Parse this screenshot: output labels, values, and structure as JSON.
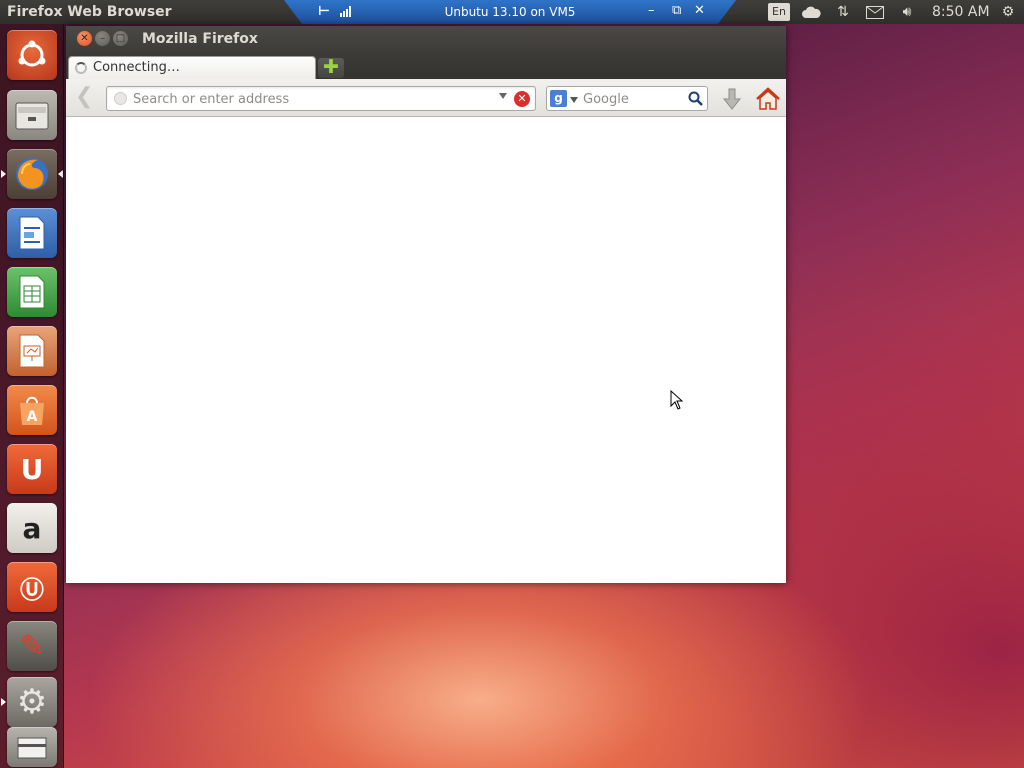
{
  "top_panel": {
    "app_title": "Firefox Web Browser",
    "vm_title": "Unbutu 13.10 on VM5",
    "language": "En",
    "clock": "8:50 AM"
  },
  "launcher": {
    "items": [
      "Dash",
      "Files",
      "Firefox Web Browser",
      "LibreOffice Writer",
      "LibreOffice Calc",
      "LibreOffice Impress",
      "Ubuntu Software Center",
      "Ubuntu One",
      "Amazon",
      "Ubuntu One Music",
      "System Settings",
      "Settings",
      "Trash"
    ]
  },
  "window": {
    "title": "Mozilla Firefox",
    "tab_label": "Connecting…",
    "address_placeholder": "Search or enter address",
    "search_placeholder": "Google"
  },
  "colors": {
    "accent": "#dd4814",
    "panel": "#3c3b37",
    "vm_bar": "#2f74c9"
  }
}
